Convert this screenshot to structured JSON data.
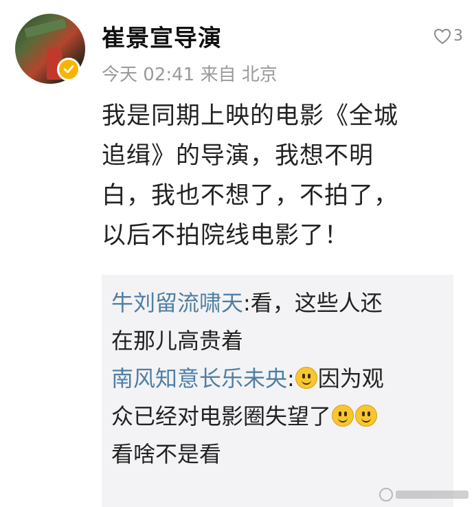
{
  "post": {
    "author_name": "崔景宣导演",
    "meta": "今天 02:41 来自 北京",
    "like_count": "3",
    "body_lines": [
      "我是同期上映的电影《全城",
      "追缉》的导演，我想不明",
      "白，我也不想了，不拍了，",
      "以后不拍院线电影了！"
    ]
  },
  "replies": [
    {
      "author": "牛刘留流啸天",
      "line1": "看，这些人还",
      "line2": "在那儿高贵着"
    },
    {
      "author": "南风知意长乐未央",
      "line1_after_emoji": "因为观",
      "line2": "众已经对电影圈失望了",
      "line3": "看啥不是看"
    }
  ],
  "icons": {
    "avatar": "avatar-photo",
    "verified": "verified-badge-icon",
    "like": "heart-outline-icon",
    "emoji": "smile-emoji-icon"
  },
  "colors": {
    "reply_author": "#4f7fa3",
    "meta_text": "#999999",
    "badge": "#f7b500",
    "reply_bg": "#f3f3f5"
  }
}
